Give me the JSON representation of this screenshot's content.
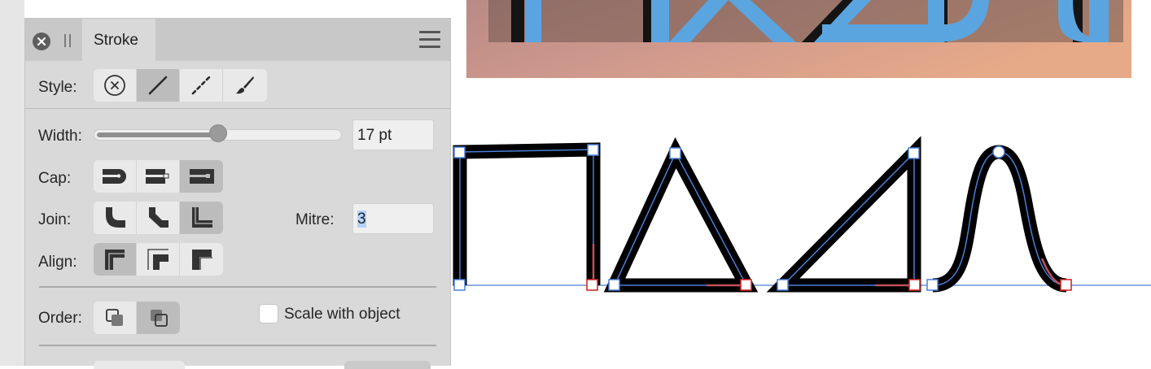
{
  "panel": {
    "tab_title": "Stroke",
    "style_label": "Style:",
    "width_label": "Width:",
    "width_value": "17 pt",
    "width_slider_fraction": 0.5,
    "cap_label": "Cap:",
    "join_label": "Join:",
    "mitre_label": "Mitre:",
    "mitre_value": "3",
    "align_label": "Align:",
    "order_label": "Order:",
    "scale_label": "Scale with object",
    "scale_checked": false,
    "style_options": [
      "none-icon",
      "solid-line-icon",
      "dashed-line-icon",
      "brush-icon"
    ],
    "style_selected": 1,
    "cap_options": [
      "butt-cap-icon",
      "round-cap-icon",
      "square-cap-icon"
    ],
    "cap_selected": 2,
    "join_options": [
      "mitre-join-icon",
      "round-join-icon",
      "bevel-join-icon"
    ],
    "join_selected": 2,
    "align_options": [
      "align-center-icon",
      "align-inside-icon",
      "align-outside-icon"
    ],
    "align_selected": 0,
    "order_options": [
      "stroke-behind-fill-icon",
      "stroke-in-front-icon"
    ],
    "order_selected": 1
  },
  "colors": {
    "accent_blue": "#4a7fd8",
    "letter_fill": "#5aa5e0",
    "selection_red": "#d22b2b"
  }
}
